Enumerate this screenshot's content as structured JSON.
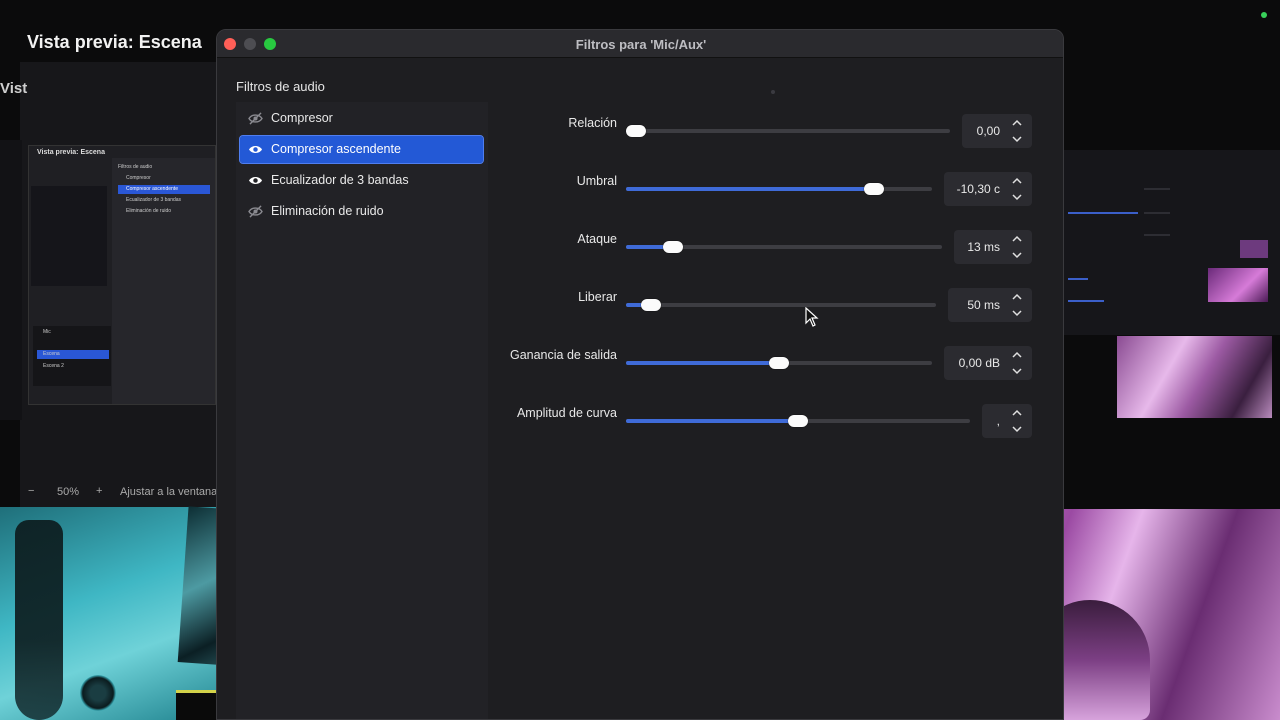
{
  "background": {
    "preview_title": "Vista previa: Escena",
    "side_label": "Vist",
    "nested_title": "Vista previa: Escena",
    "nested_filters_title": "Filtros de audio",
    "nested_items": [
      "Compresor",
      "Compresor ascendente",
      "Ecualizador de 3 bandas",
      "Eliminación de ruido"
    ],
    "nested_scenes": [
      "Mic",
      "Escena",
      "Escena 2"
    ],
    "zoom": {
      "minus": "−",
      "value": "50%",
      "plus": "+",
      "fit_label": "Ajustar a la ventana"
    }
  },
  "dialog": {
    "title": "Filtros para 'Mic/Aux'",
    "section_label": "Filtros de audio",
    "filters": [
      {
        "label": "Compresor",
        "enabled": false,
        "selected": false
      },
      {
        "label": "Compresor ascendente",
        "enabled": true,
        "selected": true
      },
      {
        "label": "Ecualizador de 3 bandas",
        "enabled": true,
        "selected": false
      },
      {
        "label": "Eliminación de ruido",
        "enabled": false,
        "selected": false
      }
    ],
    "params": [
      {
        "label": "Relación",
        "value": "0,00",
        "level": 0.03
      },
      {
        "label": "Umbral",
        "value": "-10,30 c",
        "level": 0.81
      },
      {
        "label": "Ataque",
        "value": "13 ms",
        "level": 0.15
      },
      {
        "label": "Liberar",
        "value": "50 ms",
        "level": 0.08
      },
      {
        "label": "Ganancia de salida",
        "value": "0,00 dB",
        "level": 0.5
      },
      {
        "label": "Amplitud de curva",
        "value": ",",
        "level": 0.5
      }
    ]
  },
  "colors": {
    "accent": "#2359d6",
    "slider_fill": "#3f6bd8",
    "close": "#ff5f57",
    "maximize": "#28c840"
  },
  "icons": [
    "eye-icon",
    "eye-slash-icon",
    "chevron-up-icon",
    "chevron-down-icon",
    "mouse-cursor-icon"
  ]
}
